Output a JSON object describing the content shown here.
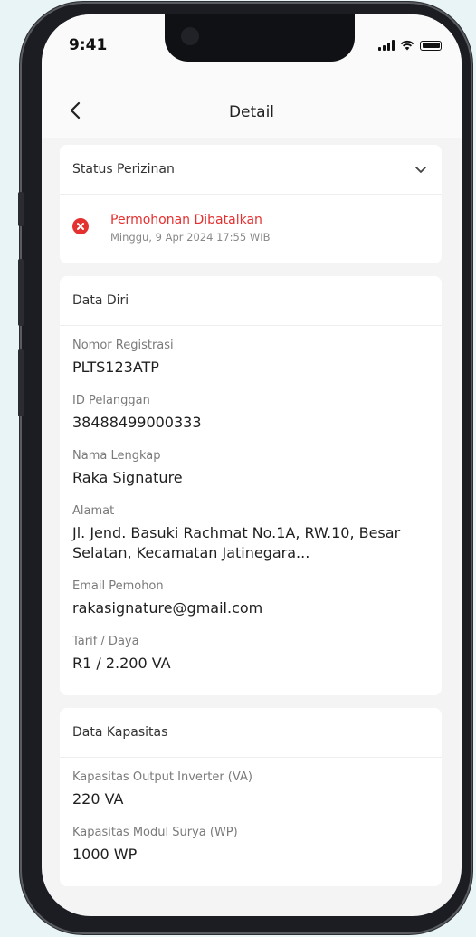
{
  "status_bar": {
    "time": "9:41"
  },
  "nav": {
    "title": "Detail"
  },
  "status_section": {
    "title": "Status Perizinan",
    "status_label": "Permohonan Dibatalkan",
    "status_date": "Minggu, 9 Apr 2024 17:55 WIB",
    "status_color": "#e53030"
  },
  "personal_section": {
    "title": "Data Diri",
    "fields": [
      {
        "label": "Nomor Registrasi",
        "value": "PLTS123ATP"
      },
      {
        "label": "ID Pelanggan",
        "value": "38488499000333"
      },
      {
        "label": "Nama Lengkap",
        "value": "Raka Signature"
      },
      {
        "label": "Alamat",
        "value": "Jl. Jend. Basuki Rachmat No.1A, RW.10, Besar Selatan, Kecamatan Jatinegara..."
      },
      {
        "label": "Email Pemohon",
        "value": "rakasignature@gmail.com"
      },
      {
        "label": "Tarif / Daya",
        "value": "R1 / 2.200 VA"
      }
    ]
  },
  "capacity_section": {
    "title": "Data Kapasitas",
    "fields": [
      {
        "label": "Kapasitas Output Inverter (VA)",
        "value": "220 VA"
      },
      {
        "label": "Kapasitas Modul Surya (WP)",
        "value": "1000 WP"
      }
    ]
  },
  "icons": {
    "back": "chevron-left-icon",
    "expand": "chevron-down-icon",
    "status": "error-x-circle-icon",
    "signal": "signal-icon",
    "wifi": "wifi-icon",
    "battery": "battery-icon"
  }
}
